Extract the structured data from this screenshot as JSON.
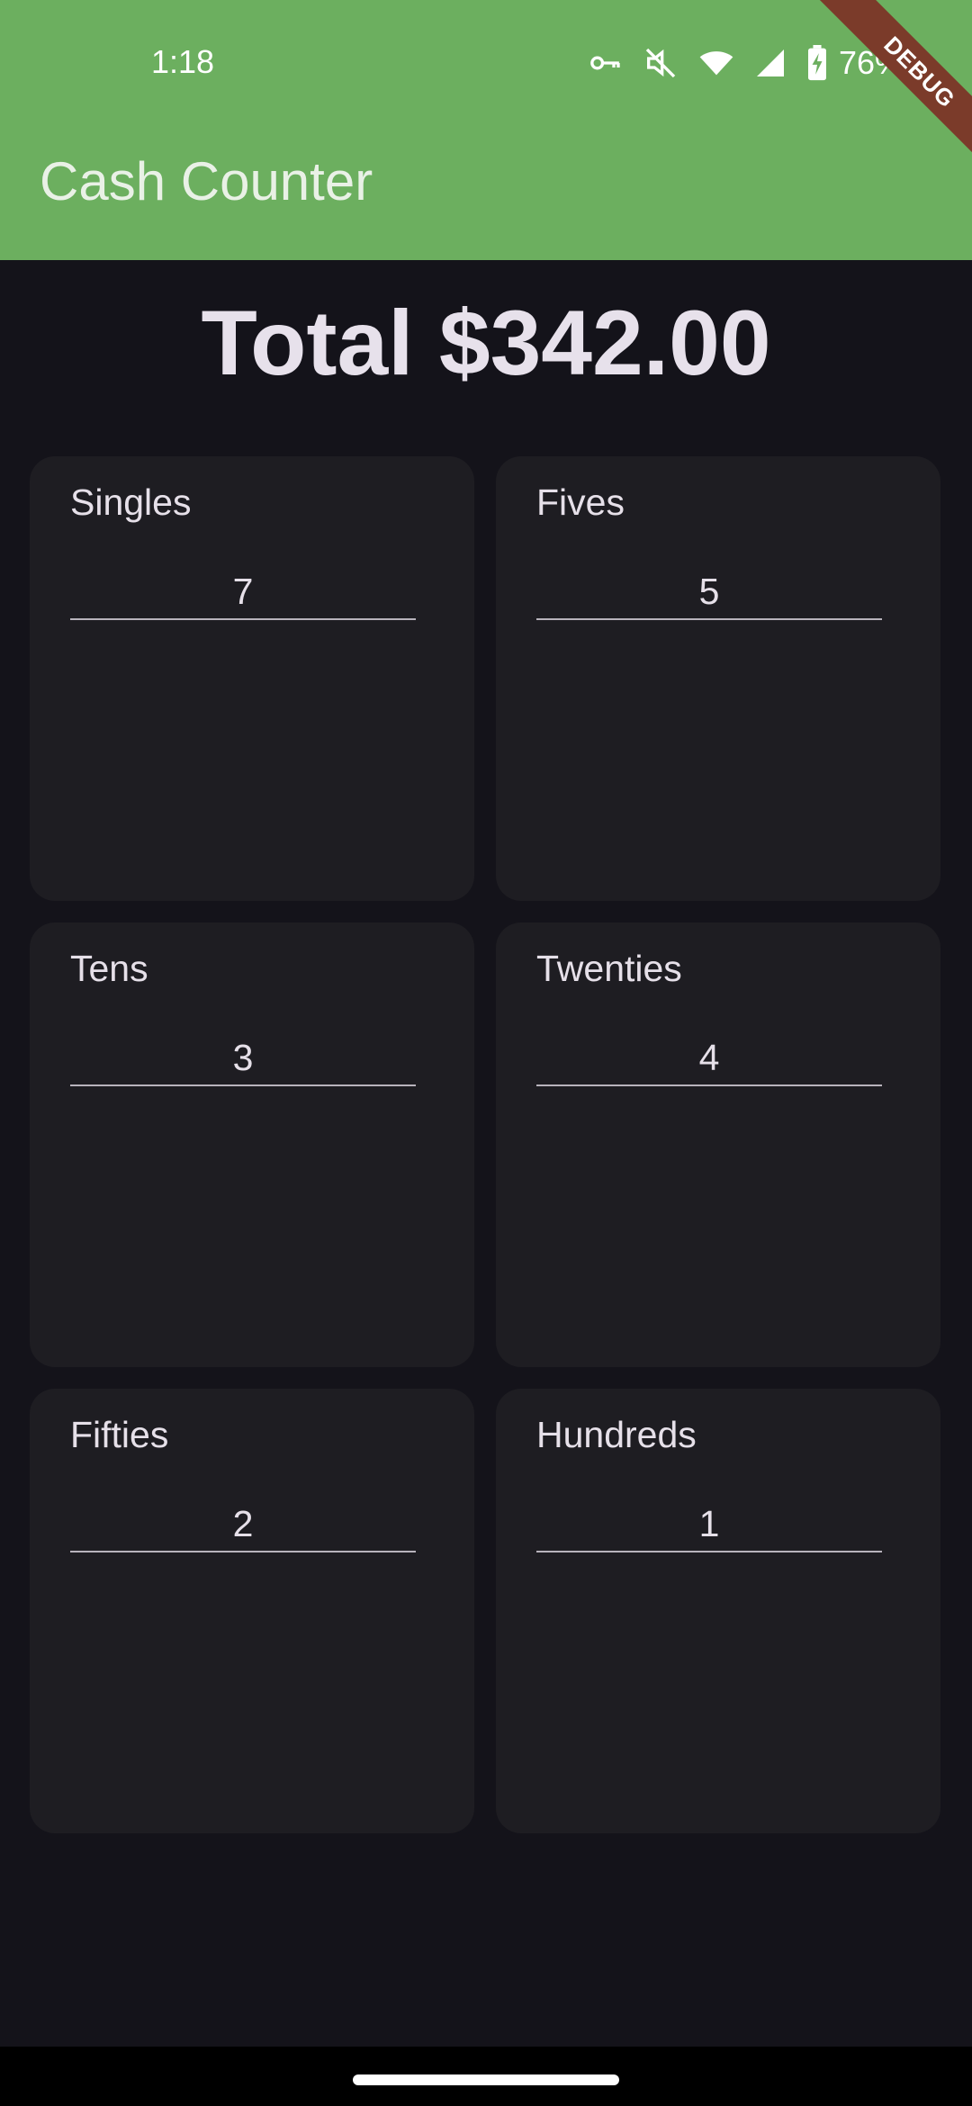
{
  "status_bar": {
    "time": "1:18",
    "battery_percent": "76%",
    "icons": [
      "vpn-key-icon",
      "mute-icon",
      "wifi-icon",
      "signal-icon",
      "battery-charging-icon"
    ]
  },
  "debug_banner": "DEBUG",
  "app_bar": {
    "title": "Cash Counter",
    "color": "#6caf5f"
  },
  "total": {
    "text": "Total $342.00"
  },
  "denominations": [
    {
      "label": "Singles",
      "count": "7"
    },
    {
      "label": "Fives",
      "count": "5"
    },
    {
      "label": "Tens",
      "count": "3"
    },
    {
      "label": "Twenties",
      "count": "4"
    },
    {
      "label": "Fifties",
      "count": "2"
    },
    {
      "label": "Hundreds",
      "count": "1"
    }
  ]
}
